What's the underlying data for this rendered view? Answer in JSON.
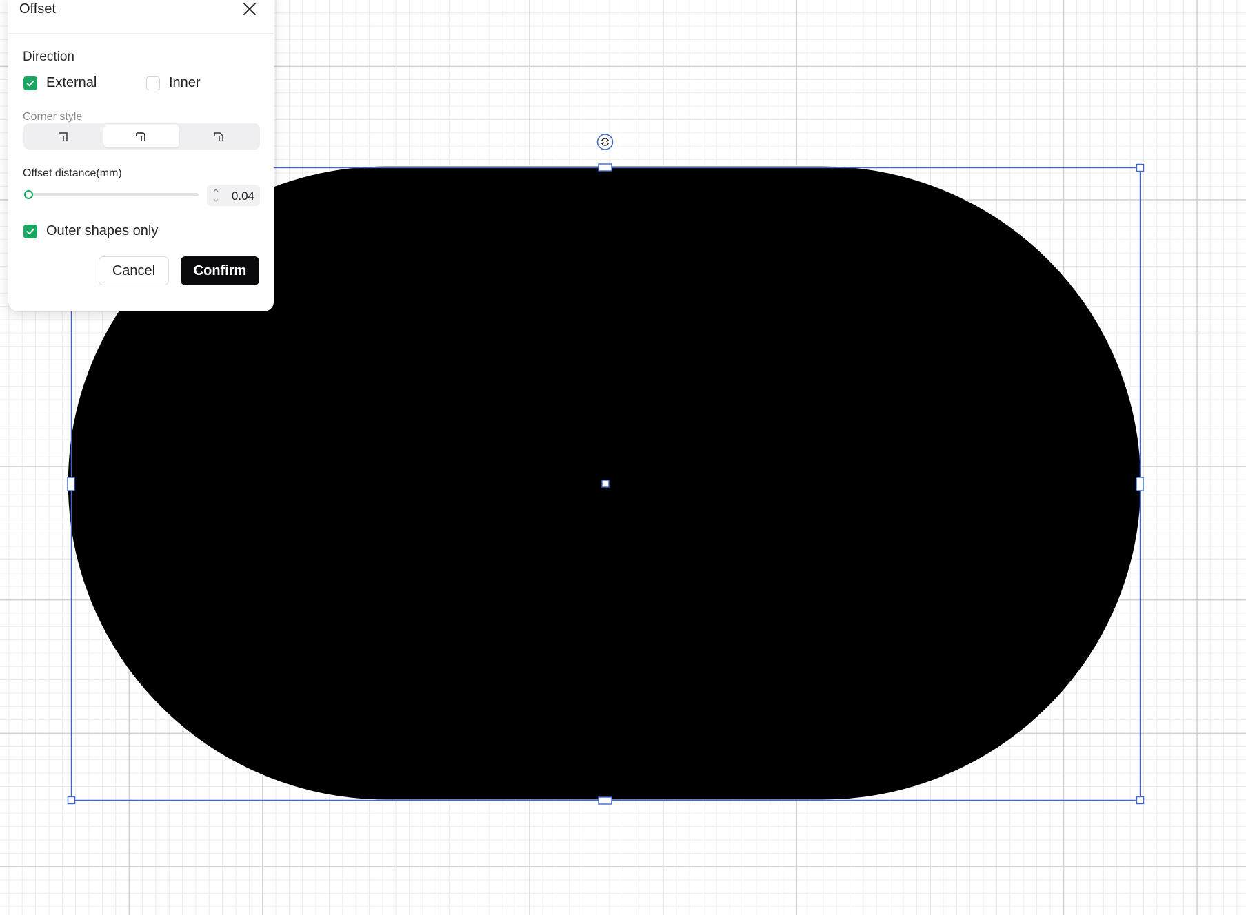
{
  "dialog": {
    "title": "Offset",
    "close_icon": "close-icon",
    "direction": {
      "label": "Direction",
      "external": {
        "label": "External",
        "checked": true
      },
      "inner": {
        "label": "Inner",
        "checked": false
      }
    },
    "corner_style": {
      "label": "Corner style",
      "options": [
        "corner-sharp-icon",
        "corner-round-icon",
        "corner-bevel-icon"
      ],
      "selected_index": 1
    },
    "offset_distance": {
      "label": "Offset distance(mm)",
      "value": "0.04",
      "slider_fraction": 0.02
    },
    "outer_shapes_only": {
      "label": "Outer shapes only",
      "checked": true
    },
    "cancel_label": "Cancel",
    "confirm_label": "Confirm"
  },
  "canvas": {
    "shape": "stadium",
    "shape_fill": "#000000",
    "selection_color": "#3b67d6",
    "rotate_icon": "rotate-icon"
  },
  "colors": {
    "accent": "#1aa761",
    "confirm_bg": "#0a0a0c"
  }
}
